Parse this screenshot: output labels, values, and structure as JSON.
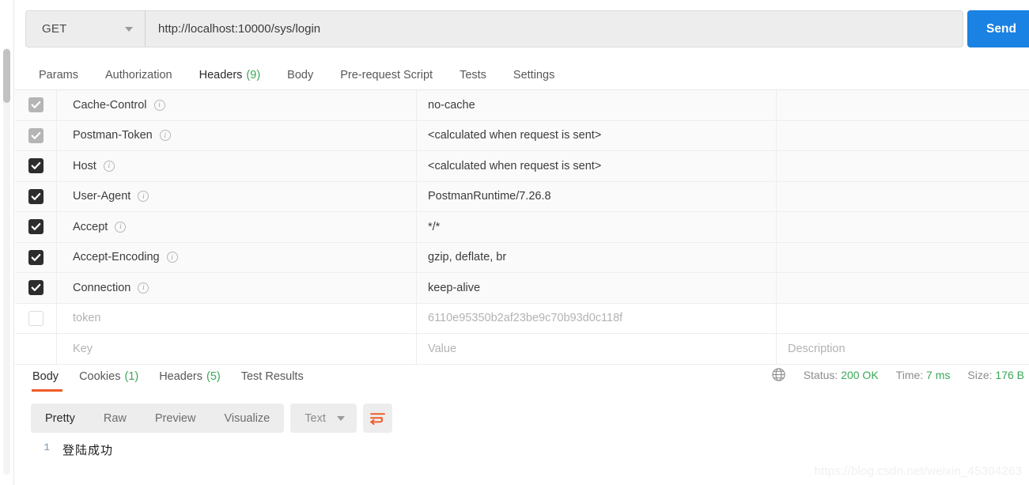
{
  "request": {
    "method": "GET",
    "url": "http://localhost:10000/sys/login",
    "send_label": "Send",
    "tabs": [
      {
        "label": "Params",
        "count": "",
        "active": false
      },
      {
        "label": "Authorization",
        "count": "",
        "active": false
      },
      {
        "label": "Headers",
        "count": "(9)",
        "active": true
      },
      {
        "label": "Body",
        "count": "",
        "active": false
      },
      {
        "label": "Pre-request Script",
        "count": "",
        "active": false
      },
      {
        "label": "Tests",
        "count": "",
        "active": false
      },
      {
        "label": "Settings",
        "count": "",
        "active": false
      }
    ]
  },
  "headers_table": {
    "placeholders": {
      "key": "Key",
      "value": "Value",
      "description": "Description"
    },
    "rows": [
      {
        "checked": "locked",
        "key": "Cache-Control",
        "value": "no-cache",
        "info": true,
        "muted": false
      },
      {
        "checked": "locked",
        "key": "Postman-Token",
        "value": "<calculated when request is sent>",
        "info": true,
        "muted": false
      },
      {
        "checked": "on",
        "key": "Host",
        "value": "<calculated when request is sent>",
        "info": true,
        "muted": false
      },
      {
        "checked": "on",
        "key": "User-Agent",
        "value": "PostmanRuntime/7.26.8",
        "info": true,
        "muted": false
      },
      {
        "checked": "on",
        "key": "Accept",
        "value": "*/*",
        "info": true,
        "muted": false
      },
      {
        "checked": "on",
        "key": "Accept-Encoding",
        "value": "gzip, deflate, br",
        "info": true,
        "muted": false
      },
      {
        "checked": "on",
        "key": "Connection",
        "value": "keep-alive",
        "info": true,
        "muted": false
      },
      {
        "checked": "off",
        "key": "token",
        "value": "6110e95350b2af23be9c70b93d0c118f",
        "info": false,
        "muted": true
      }
    ]
  },
  "response": {
    "tabs": [
      {
        "label": "Body",
        "count": "",
        "active": true
      },
      {
        "label": "Cookies",
        "count": "(1)",
        "active": false
      },
      {
        "label": "Headers",
        "count": "(5)",
        "active": false
      },
      {
        "label": "Test Results",
        "count": "",
        "active": false
      }
    ],
    "status": {
      "status_label": "Status:",
      "status_value": "200 OK",
      "time_label": "Time:",
      "time_value": "7 ms",
      "size_label": "Size:",
      "size_value": "176 B"
    },
    "viewer": {
      "modes": [
        {
          "label": "Pretty",
          "active": true
        },
        {
          "label": "Raw",
          "active": false
        },
        {
          "label": "Preview",
          "active": false
        },
        {
          "label": "Visualize",
          "active": false
        }
      ],
      "format": "Text"
    },
    "body_lines": [
      {
        "number": "1",
        "text": "登陆成功"
      }
    ]
  },
  "watermark": "https://blog.csdn.net/weixin_45304263",
  "colors": {
    "accent_orange": "#ef5b25",
    "send_blue": "#1a82e2",
    "green": "#3aa757"
  }
}
